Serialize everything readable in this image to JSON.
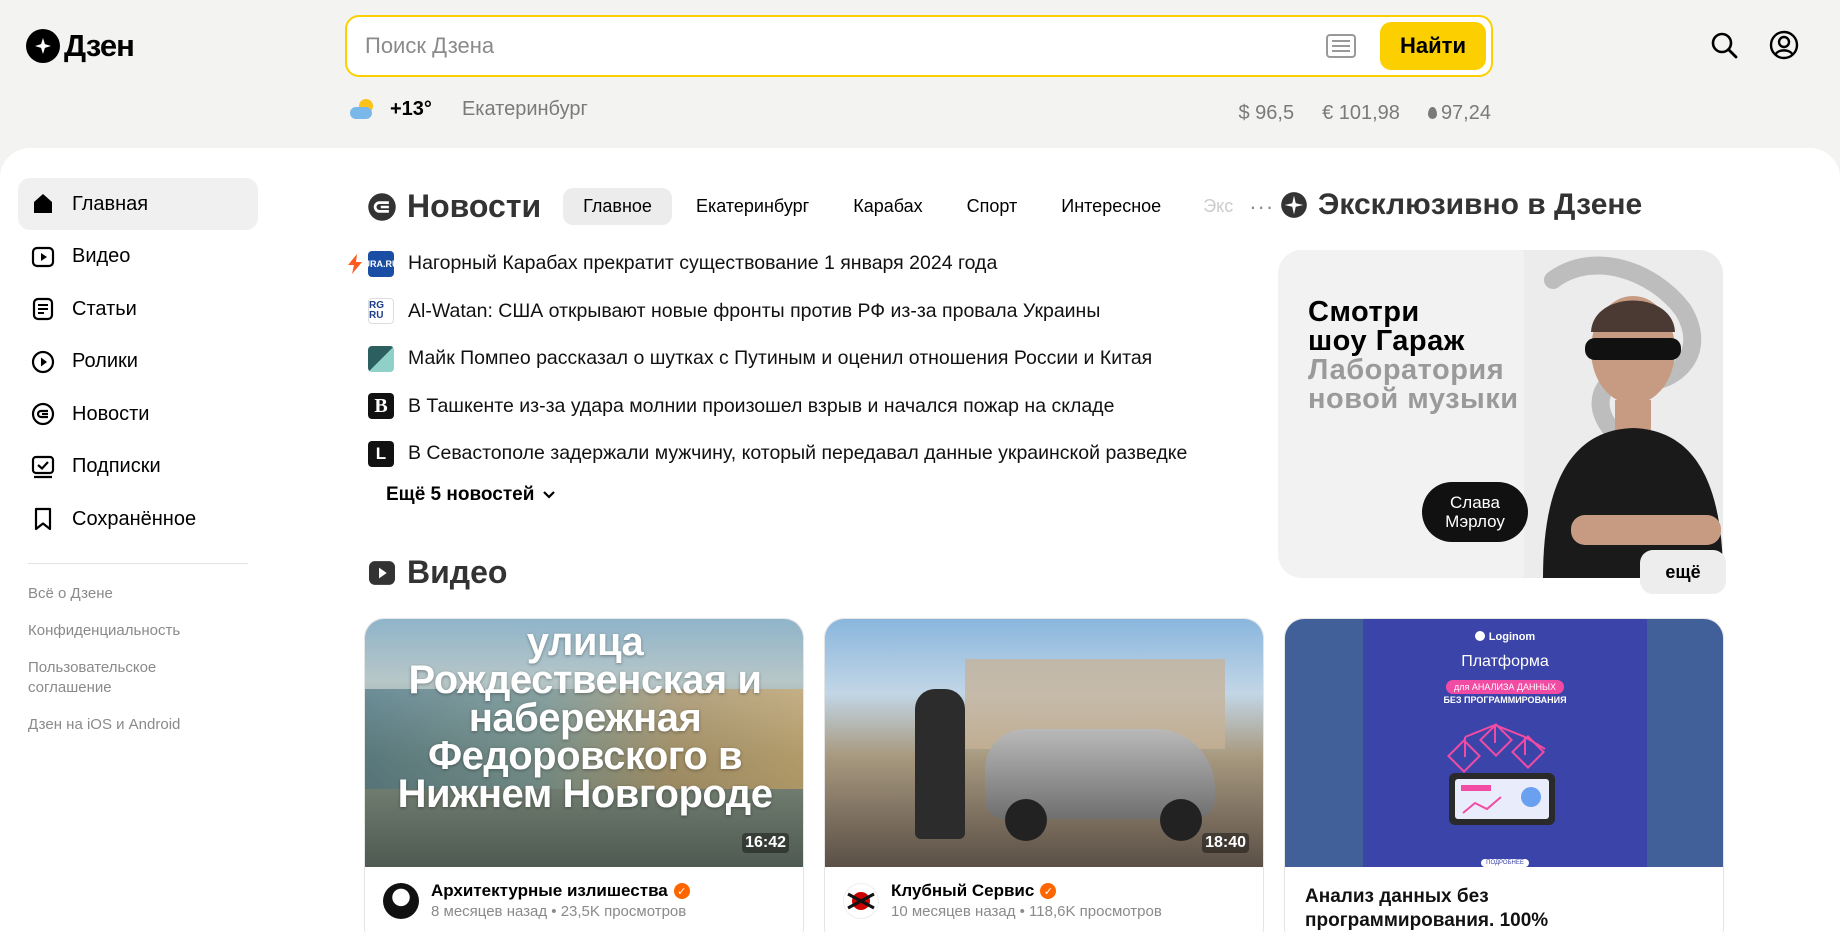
{
  "header": {
    "logo_text": "Дзен",
    "search_placeholder": "Поиск Дзена",
    "search_button": "Найти",
    "weather": {
      "temp": "+13°",
      "city": "Екатеринбург"
    },
    "rates": {
      "usd": "$ 96,5",
      "eur": "€ 101,98",
      "oil": "97,24"
    }
  },
  "sidebar": {
    "items": [
      {
        "label": "Главная",
        "icon": "home-icon"
      },
      {
        "label": "Видео",
        "icon": "video-icon"
      },
      {
        "label": "Статьи",
        "icon": "article-icon"
      },
      {
        "label": "Ролики",
        "icon": "shorts-icon"
      },
      {
        "label": "Новости",
        "icon": "news-icon"
      },
      {
        "label": "Подписки",
        "icon": "subscriptions-icon"
      },
      {
        "label": "Сохранённое",
        "icon": "bookmark-icon"
      }
    ],
    "footer_links": [
      "Всё о Дзене",
      "Конфиденциальность",
      "Пользовательское соглашение",
      "Дзен на iOS и Android"
    ]
  },
  "news": {
    "title": "Новости",
    "tabs": [
      "Главное",
      "Екатеринбург",
      "Карабах",
      "Спорт",
      "Интересное",
      "Экс"
    ],
    "items": [
      {
        "text": "Нагорный Карабах прекратит существование 1 января 2024 года",
        "source": "URA.RU"
      },
      {
        "text": "Al-Watan: США открывают новые фронты против РФ из-за провала Украины",
        "source": "RG RU"
      },
      {
        "text": "Майк Помпео рассказал о шутках с Путиным и оценил отношения России и Китая",
        "source": ""
      },
      {
        "text": "В Ташкенте из-за удара молнии произошел взрыв и начался пожар на складе",
        "source": "B"
      },
      {
        "text": "В Севастополе задержали мужчину, который передавал данные украинской разведке",
        "source": "L"
      }
    ],
    "more": "Ещё 5 новостей"
  },
  "exclusive": {
    "title": "Эксклюзивно в Дзене",
    "line1": "Смотри",
    "line2": "шоу Гараж",
    "line3": "Лаборатория",
    "line4": "новой музыки",
    "tag": "Слава Мэрлоу"
  },
  "videos": {
    "title": "Видео",
    "more": "ещё",
    "cards": [
      {
        "thumb_text": "улица Рождественская и набережная Федоровского в Нижнем Новгороде",
        "duration": "16:42",
        "channel": "Архитектурные излишества",
        "meta": "8 месяцев назад • 23,5K просмотров"
      },
      {
        "duration": "18:40",
        "channel": "Клубный Сервис",
        "meta": "10 месяцев назад • 118,6K просмотров"
      },
      {
        "ad_brand": "Loginom",
        "ad_title": "Платформа",
        "ad_pill": "для АНАЛИЗА ДАННЫХ",
        "ad_sub": "БЕЗ ПРОГРАММИРОВАНИЯ",
        "ad_btn": "ПОДРОБНЕЕ",
        "title": "Анализ данных без программирования. 100%"
      }
    ]
  }
}
